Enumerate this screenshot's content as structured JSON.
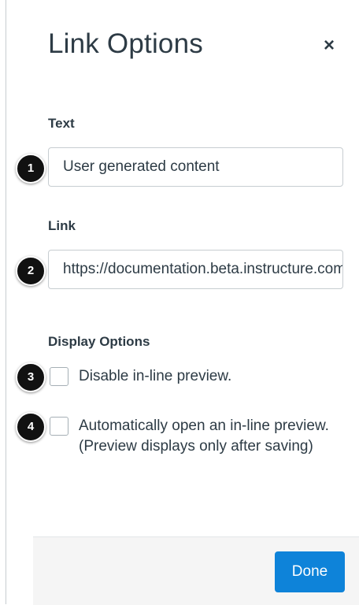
{
  "dialog": {
    "title": "Link Options",
    "close_label": "×"
  },
  "text_field": {
    "label": "Text",
    "value": "User generated content",
    "badge": "1"
  },
  "link_field": {
    "label": "Link",
    "value": "https://documentation.beta.instructure.com",
    "badge": "2"
  },
  "display_options": {
    "label": "Display Options",
    "items": [
      {
        "label": "Disable in-line preview.",
        "checked": false,
        "badge": "3"
      },
      {
        "label": "Automatically open an in-line preview. (Preview displays only after saving)",
        "checked": false,
        "badge": "4"
      }
    ]
  },
  "footer": {
    "done_label": "Done"
  },
  "colors": {
    "primary_button": "#0e83d9",
    "text": "#2d3b45",
    "badge": "#111111"
  }
}
